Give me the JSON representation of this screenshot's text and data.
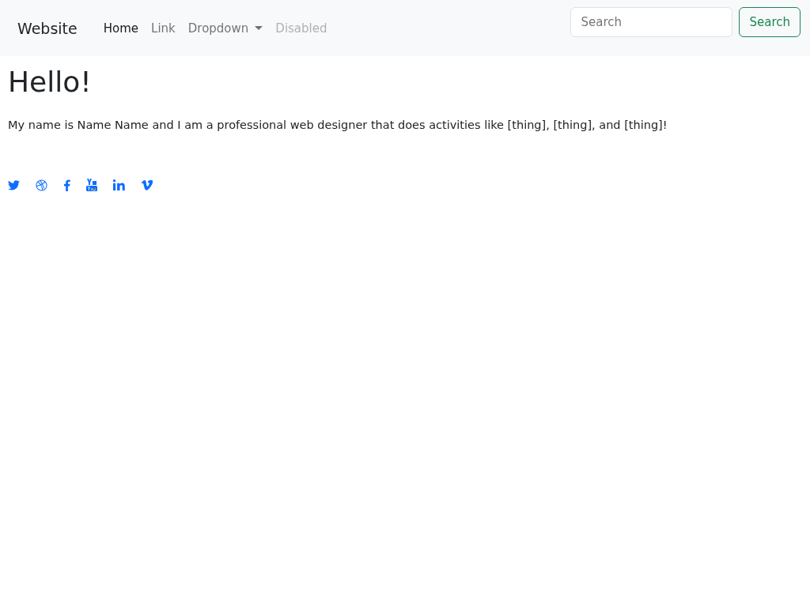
{
  "navbar": {
    "brand": "Website",
    "items": [
      {
        "label": "Home",
        "selected": true,
        "disabled": false,
        "kind": "link"
      },
      {
        "label": "Link",
        "selected": false,
        "disabled": false,
        "kind": "link"
      },
      {
        "label": "Dropdown",
        "selected": false,
        "disabled": false,
        "kind": "dropdown"
      },
      {
        "label": "Disabled",
        "selected": false,
        "disabled": true,
        "kind": "link"
      }
    ],
    "search": {
      "placeholder": "Search",
      "button": "Search"
    }
  },
  "heading": "Hello!",
  "intro": "My name is Name Name and I am a professional web designer that does activities like [thing], [thing], and [thing]!"
}
